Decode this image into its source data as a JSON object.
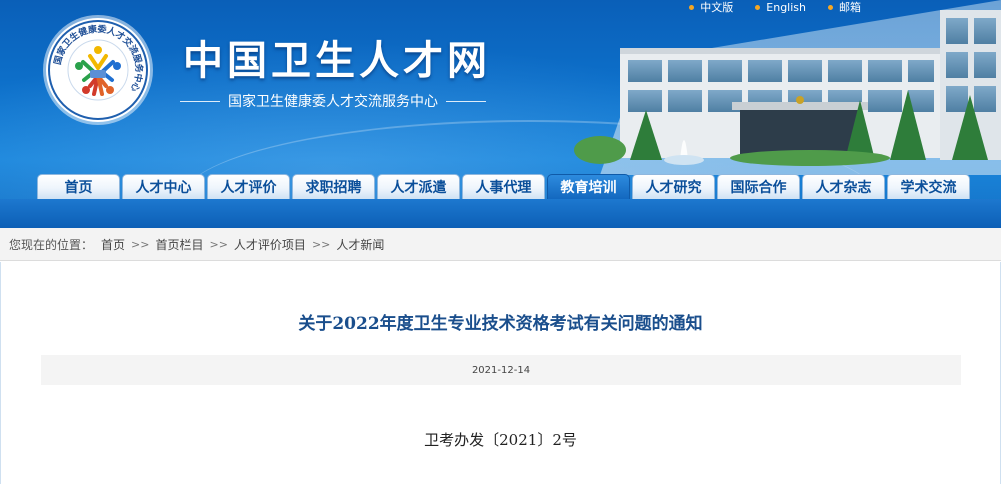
{
  "header": {
    "top_links": [
      {
        "label": "中文版",
        "icon": "bullet-dot-icon"
      },
      {
        "label": "English",
        "icon": "bullet-dot-icon"
      },
      {
        "label": "邮箱",
        "icon": "bullet-dot-icon"
      }
    ],
    "logo_text": "国家卫生健康委人才交流服务中心",
    "site_title": "中国卫生人才网",
    "site_subtitle": "国家卫生健康委人才交流服务中心"
  },
  "nav": {
    "items": [
      {
        "label": "首页"
      },
      {
        "label": "人才中心"
      },
      {
        "label": "人才评价"
      },
      {
        "label": "求职招聘"
      },
      {
        "label": "人才派遣"
      },
      {
        "label": "人事代理"
      },
      {
        "label": "教育培训",
        "active": true
      },
      {
        "label": "人才研究"
      },
      {
        "label": "国际合作"
      },
      {
        "label": "人才杂志"
      },
      {
        "label": "学术交流"
      }
    ]
  },
  "breadcrumb": {
    "prefix": "您现在的位置：",
    "separator": ">>",
    "items": [
      "首页",
      "首页栏目",
      "人才评价项目",
      "人才新闻"
    ]
  },
  "article": {
    "title": "关于2022年度卫生专业技术资格考试有关问题的通知",
    "date": "2021-12-14",
    "doc_number": "卫考办发〔2021〕2号"
  },
  "colors": {
    "banner_blue": "#0d6fc9",
    "nav_text": "#0b4f9a",
    "title_blue": "#1a4e8c",
    "accent_dot": "#f5a623"
  }
}
